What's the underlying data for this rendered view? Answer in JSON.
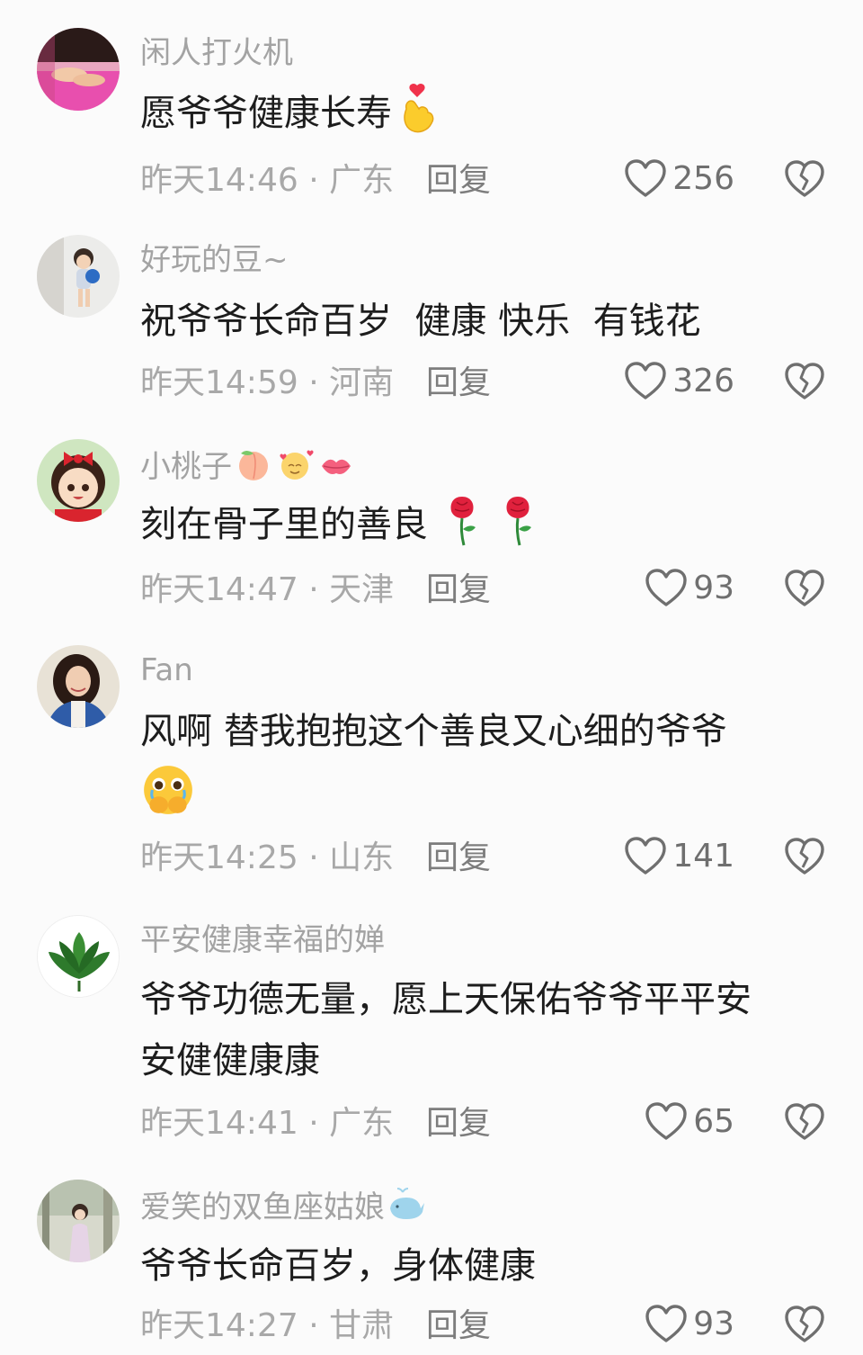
{
  "comments": [
    {
      "username": "闲人打火机",
      "text_lines": [
        "愿爷爷健康长寿"
      ],
      "time": "昨天14:46",
      "location": "广东",
      "reply_label": "回复",
      "likes": "256",
      "avatar_icon": "hands-pink-avatar",
      "emojis": [
        "finger-heart-emoji"
      ]
    },
    {
      "username": "好玩的豆~",
      "text_lines": [
        "祝爷爷长命百岁  健康 快乐  有钱花"
      ],
      "time": "昨天14:59",
      "location": "河南",
      "reply_label": "回复",
      "likes": "326",
      "avatar_icon": "child-photo-avatar"
    },
    {
      "username": "小桃子",
      "text_lines": [
        "刻在骨子里的善良"
      ],
      "time": "昨天14:47",
      "location": "天津",
      "reply_label": "回复",
      "likes": "93",
      "avatar_icon": "cartoon-girl-avatar",
      "username_emojis": [
        "peach-emoji",
        "smiling-hearts-emoji",
        "kiss-mark-emoji"
      ],
      "emojis": [
        "rose-emoji",
        "rose-emoji"
      ]
    },
    {
      "username": "Fan",
      "text_lines": [
        "风啊 替我抱抱这个善良又心细的爷爷"
      ],
      "time": "昨天14:25",
      "location": "山东",
      "reply_label": "回复",
      "likes": "141",
      "avatar_icon": "woman-photo-avatar",
      "emojis": [
        "crying-holding-back-tears-emoji"
      ]
    },
    {
      "username": "平安健康幸福的婵",
      "text_lines": [
        "爷爷功德无量，愿上天保佑爷爷平平安",
        "安健健康康"
      ],
      "time": "昨天14:41",
      "location": "广东",
      "reply_label": "回复",
      "likes": "65",
      "avatar_icon": "green-leaves-avatar"
    },
    {
      "username": "爱笑的双鱼座姑娘",
      "text_lines": [
        "爷爷长命百岁，身体健康"
      ],
      "time": "昨天14:27",
      "location": "甘肃",
      "reply_label": "回复",
      "likes": "93",
      "avatar_icon": "girl-outdoor-avatar",
      "username_emojis": [
        "whale-emoji"
      ]
    }
  ],
  "separator": " · ",
  "colors": {
    "background": "#fbfbfb",
    "username": "#a3a3a3",
    "text": "#1d1d1d",
    "meta": "#a8a8a8",
    "icon": "#6f6f6f"
  }
}
